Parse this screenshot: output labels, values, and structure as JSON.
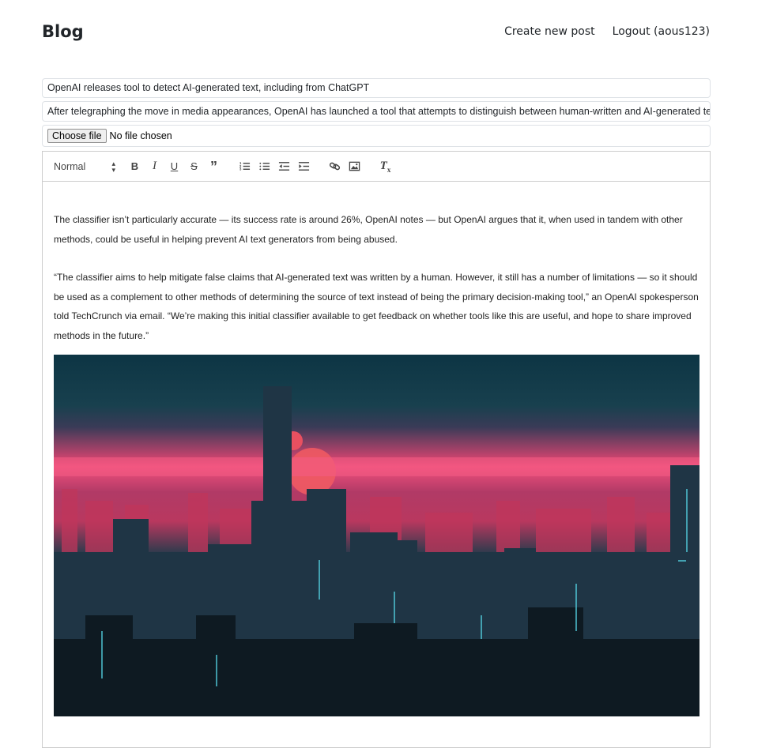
{
  "header": {
    "brand": "Blog",
    "nav": [
      {
        "label": "Create new post"
      },
      {
        "label": "Logout (aous123)"
      }
    ]
  },
  "form": {
    "title_value": "OpenAI releases tool to detect AI-generated text, including from ChatGPT",
    "description_value": "After telegraphing the move in media appearances, OpenAI has launched a tool that attempts to distinguish between human-written and AI-generated text —",
    "file_button": "Choose file",
    "file_status": "No file chosen"
  },
  "editor": {
    "format_select": "Normal",
    "toolbar_icons": [
      "bold-icon",
      "italic-icon",
      "underline-icon",
      "strike-icon",
      "blockquote-icon",
      "ordered-list-icon",
      "bullet-list-icon",
      "outdent-icon",
      "indent-icon",
      "link-icon",
      "image-icon",
      "clear-format-icon"
    ],
    "paragraphs": [
      "The classifier isn’t particularly accurate — its success rate is around 26%, OpenAI notes — but OpenAI argues that it, when used in tandem with other methods, could be useful in helping prevent AI text generators from being abused.",
      "“The classifier aims to help mitigate false claims that AI-generated text was written by a human. However, it still has a number of limitations — so it should be used as a complement to other methods of determining the source of text instead of being the primary decision-making tool,” an OpenAI spokesperson told TechCrunch via email. “We’re making this initial classifier available to get feedback on whether tools like this are useful, and hope to share improved methods in the future.”"
    ]
  }
}
